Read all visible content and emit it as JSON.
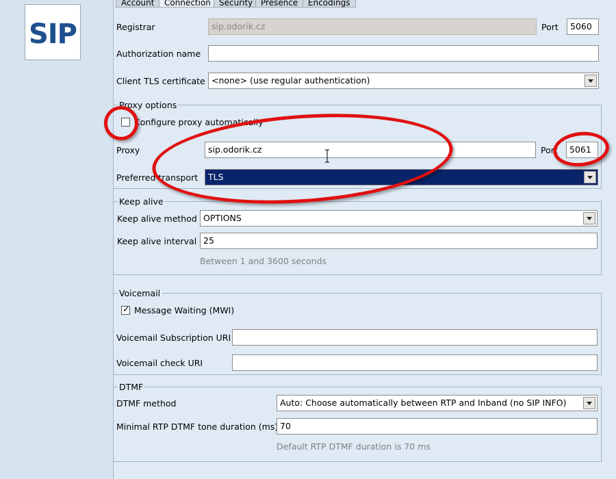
{
  "logo": {
    "text": "SIP"
  },
  "tabs": [
    "Account",
    "Connection",
    "Security",
    "Presence",
    "Encodings"
  ],
  "registrar": {
    "label": "Registrar",
    "value": "sip.odorik.cz",
    "port_label": "Port",
    "port": "5060"
  },
  "authorization": {
    "label": "Authorization name",
    "value": ""
  },
  "client_tls": {
    "label": "Client TLS certificate",
    "value": "<none> (use regular authentication)"
  },
  "proxy_options": {
    "legend": "Proxy options",
    "auto_label": "Configure proxy automatically",
    "auto_checked": false,
    "proxy_label": "Proxy",
    "proxy_value": "sip.odorik.cz",
    "port_label": "Port",
    "port": "5061",
    "transport_label": "Preferred transport",
    "transport_value": "TLS"
  },
  "keep_alive": {
    "legend": "Keep alive",
    "method_label": "Keep alive method",
    "method_value": "OPTIONS",
    "interval_label": "Keep alive interval",
    "interval_value": "25",
    "hint": "Between 1 and 3600 seconds"
  },
  "voicemail": {
    "legend": "Voicemail",
    "mwi_label": "Message Waiting (MWI)",
    "mwi_checked": true,
    "sub_uri_label": "Voicemail Subscription URI",
    "sub_uri_value": "",
    "check_uri_label": "Voicemail check URI",
    "check_uri_value": ""
  },
  "dtmf": {
    "legend": "DTMF",
    "method_label": "DTMF method",
    "method_value": "Auto: Choose automatically between RTP and Inband (no SIP INFO)",
    "duration_label": "Minimal RTP DTMF tone duration (ms)",
    "duration_value": "70",
    "hint": "Default RTP DTMF duration is 70 ms"
  },
  "colors": {
    "annotation": "#e01010",
    "selection": "#0a246a",
    "background": "#d6e4f0"
  }
}
